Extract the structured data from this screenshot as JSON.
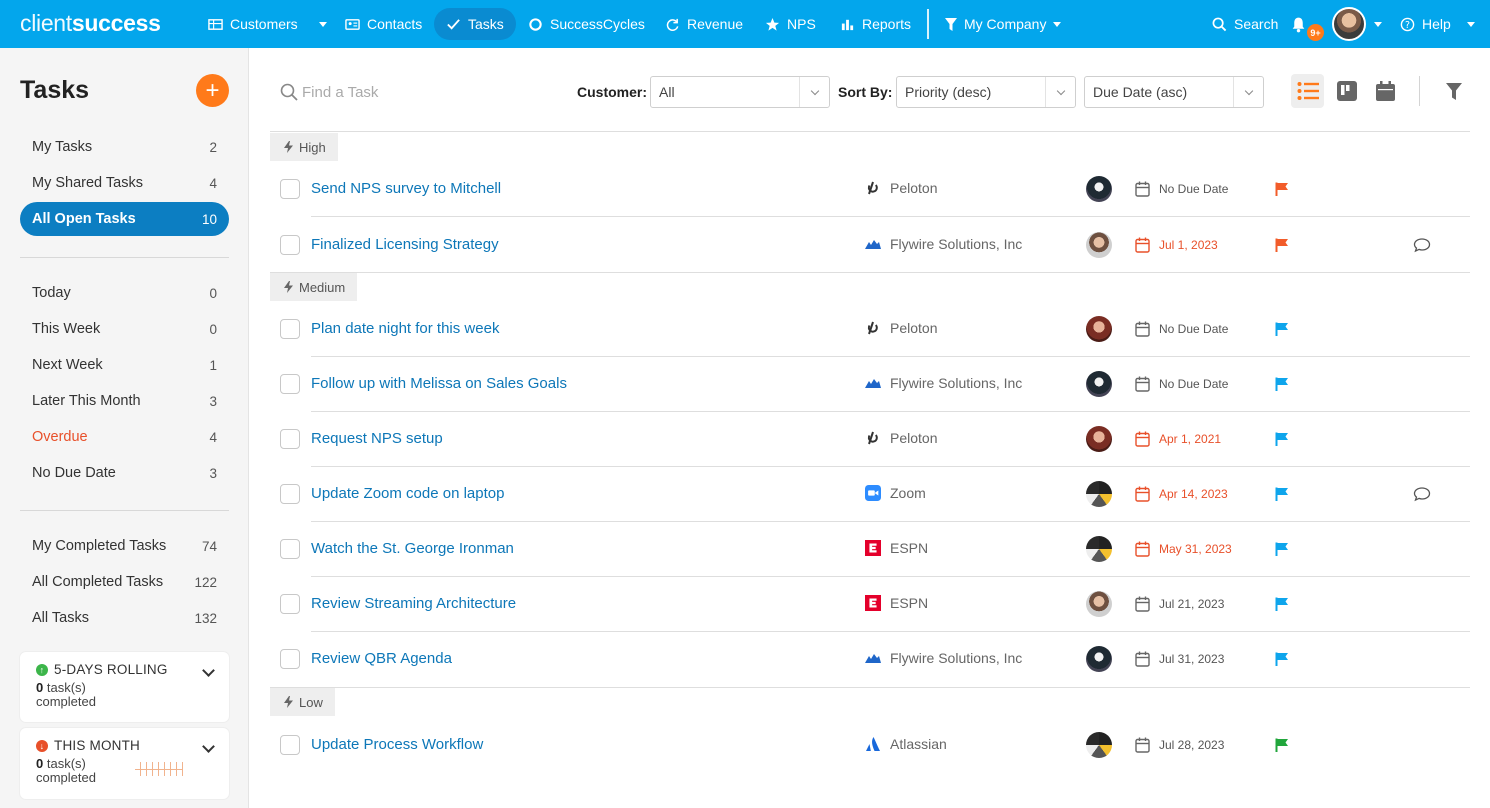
{
  "nav": {
    "logo_a": "client",
    "logo_b": "success",
    "items": [
      {
        "label": "Customers",
        "icon": "table-icon"
      },
      {
        "label": "Contacts",
        "icon": "contact-card-icon"
      },
      {
        "label": "Tasks",
        "icon": "check-icon"
      },
      {
        "label": "SuccessCycles",
        "icon": "cycle-icon"
      },
      {
        "label": "Revenue",
        "icon": "refresh-icon"
      },
      {
        "label": "NPS",
        "icon": "star-icon"
      },
      {
        "label": "Reports",
        "icon": "bar-chart-icon"
      }
    ],
    "company": "My Company",
    "search": "Search",
    "badge": "9+",
    "help": "Help"
  },
  "sidebar": {
    "title": "Tasks",
    "add_icon": "+",
    "groups": [
      [
        {
          "label": "My Tasks",
          "count": "2"
        },
        {
          "label": "My Shared Tasks",
          "count": "4"
        },
        {
          "label": "All Open Tasks",
          "count": "10",
          "active": true
        }
      ],
      [
        {
          "label": "Today",
          "count": "0"
        },
        {
          "label": "This Week",
          "count": "0"
        },
        {
          "label": "Next Week",
          "count": "1"
        },
        {
          "label": "Later This Month",
          "count": "3"
        },
        {
          "label": "Overdue",
          "count": "4",
          "overdue": true
        },
        {
          "label": "No Due Date",
          "count": "3"
        }
      ],
      [
        {
          "label": "My Completed Tasks",
          "count": "74"
        },
        {
          "label": "All Completed Tasks",
          "count": "122"
        },
        {
          "label": "All Tasks",
          "count": "132"
        }
      ]
    ],
    "cards": [
      {
        "title": "5-DAYS ROLLING",
        "count": "0",
        "line1": "task(s)",
        "line2": "completed",
        "color": "#3cb54a",
        "arrow": "↑"
      },
      {
        "title": "THIS MONTH",
        "count": "0",
        "line1": "task(s)",
        "line2": "completed",
        "color": "#e8502a",
        "arrow": "↓"
      }
    ]
  },
  "toolbar": {
    "search_placeholder": "Find a Task",
    "customer_label": "Customer:",
    "customer_value": "All",
    "sort_label": "Sort By:",
    "sort_value": "Priority (desc)",
    "sort2_value": "Due Date (asc)"
  },
  "colors": {
    "flag_high": "#f25c2a",
    "flag_medium": "#0ea5ec",
    "flag_low": "#21a63c"
  },
  "groups": [
    {
      "label": "High",
      "flag": "high",
      "tasks": [
        {
          "name": "Send NPS survey to Mitchell",
          "customer": "Peloton",
          "logo": "peloton",
          "avatar": "a1",
          "due": "No Due Date",
          "overdue": false,
          "comment": false
        },
        {
          "name": "Finalized Licensing Strategy",
          "customer": "Flywire Solutions, Inc",
          "logo": "flywire",
          "avatar": "a2",
          "due": "Jul 1, 2023",
          "overdue": true,
          "comment": true
        }
      ]
    },
    {
      "label": "Medium",
      "flag": "medium",
      "tasks": [
        {
          "name": "Plan date night for this week",
          "customer": "Peloton",
          "logo": "peloton",
          "avatar": "a3",
          "due": "No Due Date",
          "overdue": false,
          "comment": false
        },
        {
          "name": "Follow up with Melissa on Sales Goals",
          "customer": "Flywire Solutions, Inc",
          "logo": "flywire",
          "avatar": "a1",
          "due": "No Due Date",
          "overdue": false,
          "comment": false
        },
        {
          "name": "Request NPS setup",
          "customer": "Peloton",
          "logo": "peloton",
          "avatar": "a3",
          "due": "Apr 1, 2021",
          "overdue": true,
          "comment": false
        },
        {
          "name": "Update Zoom code on laptop",
          "customer": "Zoom",
          "logo": "zoom",
          "avatar": "a4",
          "due": "Apr 14, 2023",
          "overdue": true,
          "comment": true
        },
        {
          "name": "Watch the St. George Ironman",
          "customer": "ESPN",
          "logo": "espn",
          "avatar": "a4",
          "due": "May 31, 2023",
          "overdue": true,
          "comment": false
        },
        {
          "name": "Review Streaming Architecture",
          "customer": "ESPN",
          "logo": "espn",
          "avatar": "a2",
          "due": "Jul 21, 2023",
          "overdue": false,
          "comment": false
        },
        {
          "name": "Review QBR Agenda",
          "customer": "Flywire Solutions, Inc",
          "logo": "flywire",
          "avatar": "a1",
          "due": "Jul 31, 2023",
          "overdue": false,
          "comment": false
        }
      ]
    },
    {
      "label": "Low",
      "flag": "low",
      "tasks": [
        {
          "name": "Update Process Workflow",
          "customer": "Atlassian",
          "logo": "atlassian",
          "avatar": "a4",
          "due": "Jul 28, 2023",
          "overdue": false,
          "comment": false
        }
      ]
    }
  ]
}
